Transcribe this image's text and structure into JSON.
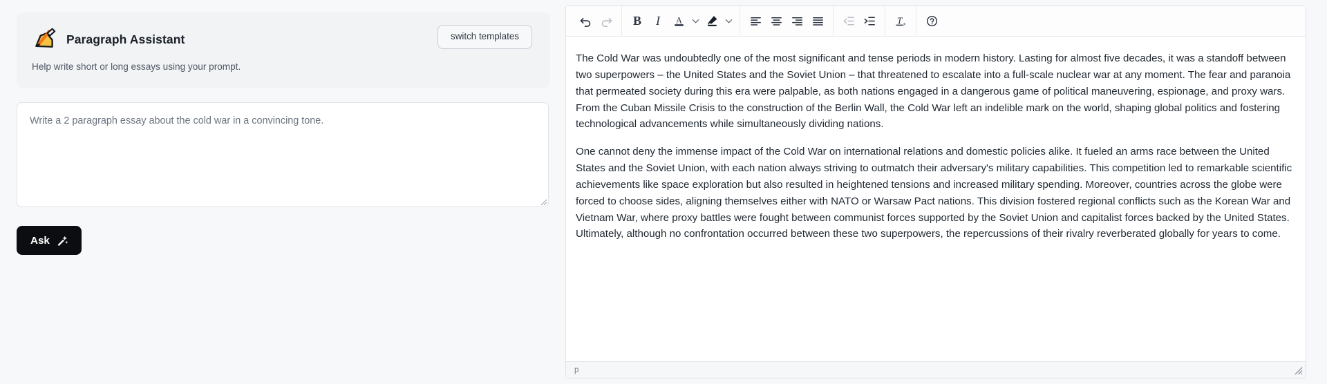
{
  "assistant": {
    "icon": "writing-hand-icon",
    "title": "Paragraph Assistant",
    "subtitle": "Help write short or long essays using your prompt.",
    "switch_templates_label": "switch templates",
    "prompt_placeholder": "Write a 2 paragraph essay about the cold war in a convincing tone.",
    "prompt_value": "",
    "ask_label": "Ask",
    "ask_icon": "magic-wand-icon"
  },
  "editor": {
    "toolbar": [
      {
        "group": 0,
        "name": "undo-button",
        "icon": "undo-arrow-icon",
        "glyph": "undo",
        "state": "enabled"
      },
      {
        "group": 0,
        "name": "redo-button",
        "icon": "redo-arrow-icon",
        "glyph": "redo",
        "state": "disabled"
      },
      {
        "group": 1,
        "name": "bold-button",
        "icon": "bold-icon",
        "glyph": "B",
        "state": "enabled"
      },
      {
        "group": 1,
        "name": "italic-button",
        "icon": "italic-icon",
        "glyph": "I",
        "state": "enabled"
      },
      {
        "group": 1,
        "name": "text-color-button",
        "icon": "text-color-a-icon",
        "glyph": "A",
        "state": "enabled"
      },
      {
        "group": 1,
        "name": "text-color-dropdown",
        "icon": "chevron-down-icon",
        "glyph": "chevron",
        "state": "enabled"
      },
      {
        "group": 1,
        "name": "highlight-color-button",
        "icon": "highlighter-pen-icon",
        "glyph": "pen",
        "state": "enabled"
      },
      {
        "group": 1,
        "name": "highlight-color-dropdown",
        "icon": "chevron-down-icon",
        "glyph": "chevron",
        "state": "enabled"
      },
      {
        "group": 2,
        "name": "align-left-button",
        "icon": "align-left-icon",
        "glyph": "align-left",
        "state": "enabled"
      },
      {
        "group": 2,
        "name": "align-center-button",
        "icon": "align-center-icon",
        "glyph": "align-center",
        "state": "enabled"
      },
      {
        "group": 2,
        "name": "align-right-button",
        "icon": "align-right-icon",
        "glyph": "align-right",
        "state": "enabled"
      },
      {
        "group": 2,
        "name": "align-justify-button",
        "icon": "align-justify-icon",
        "glyph": "align-justify",
        "state": "enabled"
      },
      {
        "group": 3,
        "name": "outdent-button",
        "icon": "outdent-icon",
        "glyph": "outdent",
        "state": "disabled"
      },
      {
        "group": 3,
        "name": "indent-button",
        "icon": "indent-icon",
        "glyph": "indent",
        "state": "enabled"
      },
      {
        "group": 4,
        "name": "clear-formatting-button",
        "icon": "clear-formatting-tx-icon",
        "glyph": "tx",
        "state": "enabled"
      },
      {
        "group": 5,
        "name": "help-button",
        "icon": "help-question-circle-icon",
        "glyph": "help",
        "state": "enabled"
      }
    ],
    "paragraphs": [
      "The Cold War was undoubtedly one of the most significant and tense periods in modern history. Lasting for almost five decades, it was a standoff between two superpowers – the United States and the Soviet Union – that threatened to escalate into a full-scale nuclear war at any moment. The fear and paranoia that permeated society during this era were palpable, as both nations engaged in a dangerous game of political maneuvering, espionage, and proxy wars. From the Cuban Missile Crisis to the construction of the Berlin Wall, the Cold War left an indelible mark on the world, shaping global politics and fostering technological advancements while simultaneously dividing nations.",
      "One cannot deny the immense impact of the Cold War on international relations and domestic policies alike. It fueled an arms race between the United States and the Soviet Union, with each nation always striving to outmatch their adversary's military capabilities. This competition led to remarkable scientific achievements like space exploration but also resulted in heightened tensions and increased military spending. Moreover, countries across the globe were forced to choose sides, aligning themselves either with NATO or Warsaw Pact nations. This division fostered regional conflicts such as the Korean War and Vietnam War, where proxy battles were fought between communist forces supported by the Soviet Union and capitalist forces backed by the United States. Ultimately, although no confrontation occurred between these two superpowers, the repercussions of their rivalry reverberated globally for years to come."
    ],
    "status_path": "p",
    "resize_grip": "resize-grip-icon"
  },
  "colors": {
    "page_background": "#f7f8fa",
    "card_background": "#f1f3f5",
    "ask_button_background": "#0b0d11",
    "editor_background": "#ffffff",
    "border": "#dde1e6",
    "text": "#222a33"
  }
}
